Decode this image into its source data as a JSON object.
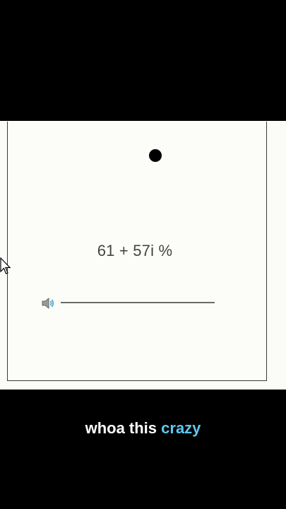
{
  "app": {
    "volume_text": "61 + 57i %",
    "volume_level_fraction": 1.0
  },
  "icons": {
    "speaker": "speaker-icon",
    "cursor": "mouse-pointer-icon"
  },
  "caption": {
    "prefix": "whoa this ",
    "highlight": "crazy"
  },
  "colors": {
    "caption_highlight": "#5ec8f0",
    "caption_text": "#ffffff",
    "ball": "#000000",
    "speaker_wave": "#3aa0c8"
  }
}
